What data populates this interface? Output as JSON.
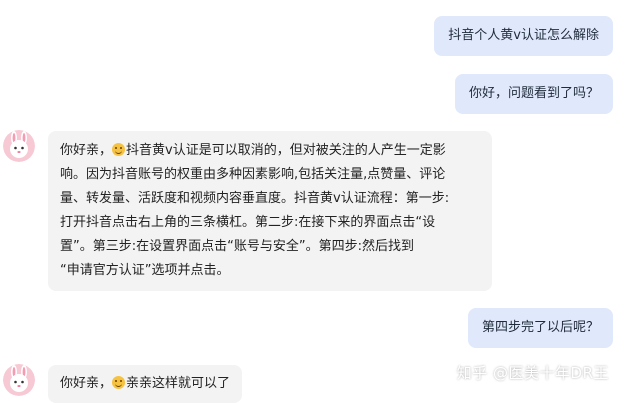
{
  "messages": [
    {
      "role": "user",
      "text": "抖音个人黄v认证怎么解除"
    },
    {
      "role": "user",
      "text": "你好，问题看到了吗？"
    },
    {
      "role": "bot",
      "lines": [
        "你好亲，",
        "抖音黄v认证是可以取消的，但对被关注的人产生一定影",
        "响。因为抖音账号的权重由多种因素影响,包括关注量,点赞量、评论",
        "量、转发量、活跃度和视频内容垂直度。抖音黄v认证流程：第一步:",
        "打开抖音点击右上角的三条横杠。第二步:在接下来的界面点击“设",
        "置”。第三步:在设置界面点击“账号与安全”。第四步:然后找到",
        "“申请官方认证”选项并点击。"
      ]
    },
    {
      "role": "user",
      "text": "第四步完了以后呢？"
    },
    {
      "role": "bot",
      "lines": [
        "你好亲，",
        "亲亲这样就可以了"
      ]
    }
  ],
  "watermark": "知乎 @医美十年DR王",
  "icons": {
    "avatar": "bunny-avatar-icon",
    "emoji": "smile-emoji-icon"
  },
  "colors": {
    "user_bubble": "#dfe9fb",
    "bot_bubble": "#f3f3f4",
    "avatar_bg": "#f7c9d4"
  }
}
